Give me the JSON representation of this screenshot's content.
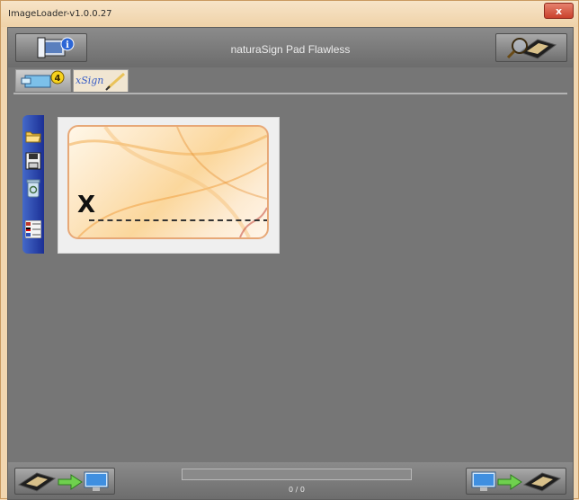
{
  "window": {
    "title": "ImageLoader-v1.0.0.27",
    "close_label": "x"
  },
  "header": {
    "title": "naturaSign Pad Flawless"
  },
  "tabs": [
    {
      "name": "images",
      "badge": "4"
    },
    {
      "name": "xsign",
      "label": "xSign"
    }
  ],
  "card": {
    "mark": "X"
  },
  "footer": {
    "counter": "0 / 0",
    "progress": 0
  },
  "icons": [
    "info-icon",
    "magnifier-pad-icon",
    "folder-icon",
    "save-icon",
    "recycle-icon",
    "flag-notes-icon",
    "pad-to-monitor-icon",
    "monitor-to-pad-icon"
  ],
  "colors": {
    "accent_blue": "#2a44a8",
    "arrow_green": "#58c24a",
    "window_frame": "#f1d6b0"
  }
}
